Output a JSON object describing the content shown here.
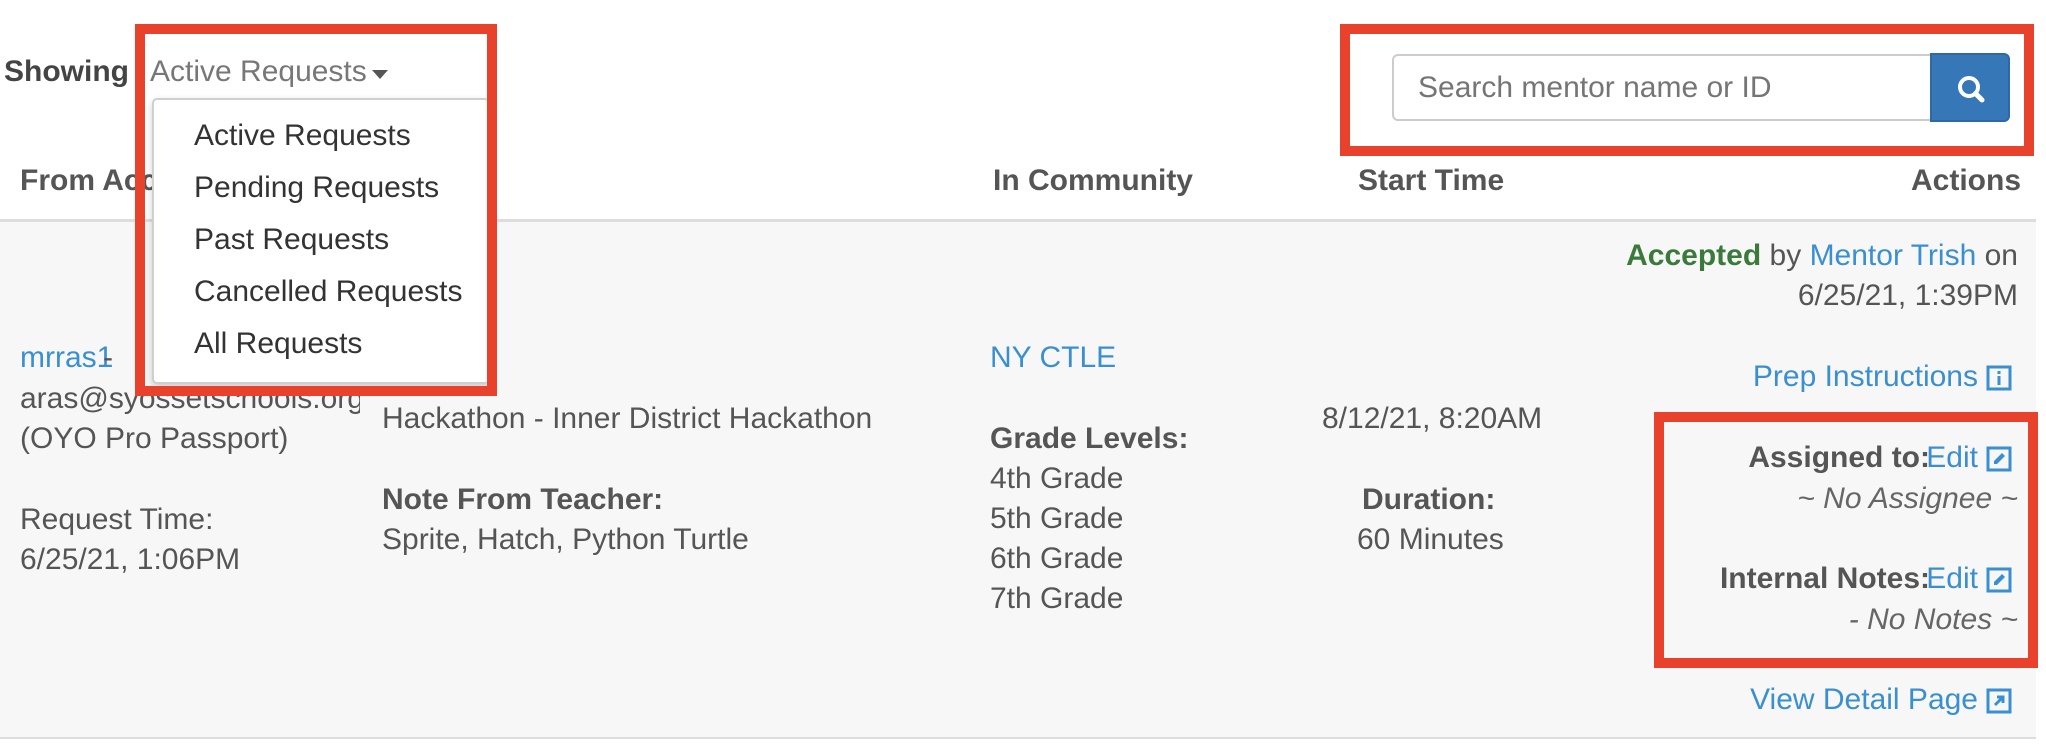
{
  "filter": {
    "showing_label": "Showing",
    "selected": "Active Requests",
    "options": [
      "Active Requests",
      "Pending Requests",
      "Past Requests",
      "Cancelled Requests",
      "All Requests"
    ]
  },
  "search": {
    "placeholder": "Search mentor name or ID"
  },
  "table": {
    "headers": {
      "from": "From Acc",
      "community": "In Community",
      "start": "Start Time",
      "actions": "Actions"
    },
    "row": {
      "from": {
        "username": "mrras1",
        "dash": "-",
        "email": "aras@syossetschools.org",
        "passport": "(OYO Pro Passport)",
        "request_time_label": "Request Time:",
        "request_time": "6/25/21, 1:06PM"
      },
      "event": {
        "name": "Hackathon - Inner District Hackathon",
        "note_label": "Note From Teacher:",
        "note": "Sprite, Hatch, Python Turtle"
      },
      "community": {
        "name": "NY CTLE",
        "grade_label": "Grade Levels:",
        "grades": [
          "4th Grade",
          "5th Grade",
          "6th Grade",
          "7th Grade"
        ]
      },
      "start": {
        "time": "8/12/21, 8:20AM",
        "duration_label": "Duration:",
        "duration": "60 Minutes"
      },
      "actions": {
        "status": "Accepted",
        "by": "by",
        "mentor": "Mentor Trish",
        "on": "on",
        "date": "6/25/21, 1:39PM",
        "prep": "Prep Instructions",
        "assigned_label": "Assigned to:",
        "edit": "Edit",
        "no_assignee": "~ No Assignee ~",
        "notes_label": "Internal Notes:",
        "no_notes": "- No Notes ~",
        "view_detail": "View Detail Page"
      }
    }
  },
  "colors": {
    "accent": "#3a8fd0",
    "accepted": "#3c7a3c",
    "highlight": "#e8412c",
    "button": "#3677b8"
  }
}
